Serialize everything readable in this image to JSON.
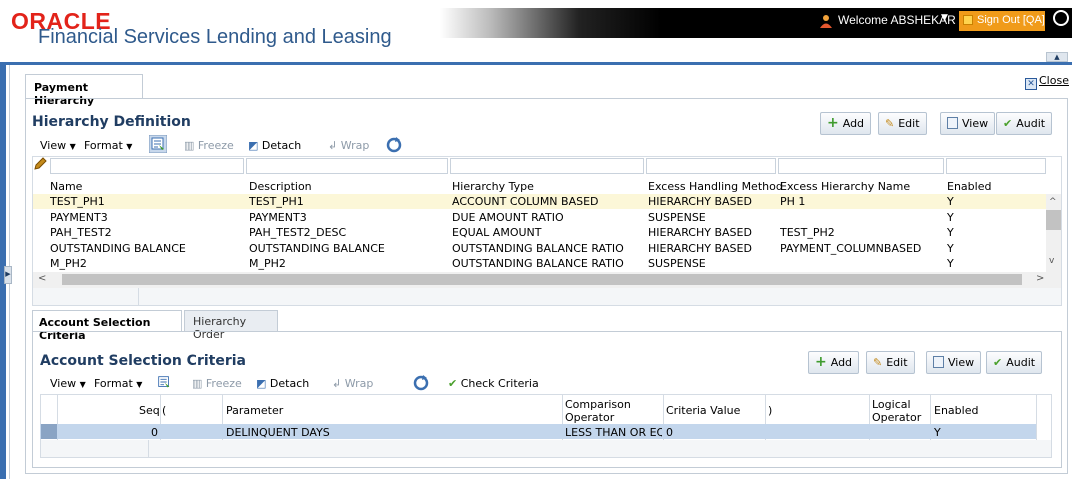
{
  "header": {
    "logo": "ORACLE",
    "app_title": "Financial Services Lending and Leasing",
    "welcome": "Welcome ABSHEKAR",
    "signout": "Sign Out [QA]"
  },
  "tab": {
    "label": "Payment Hierarchy",
    "close_label": "Close"
  },
  "hierarchy": {
    "title": "Hierarchy Definition",
    "actions": {
      "add": "Add",
      "edit": "Edit",
      "view": "View",
      "audit": "Audit"
    },
    "toolbar": {
      "view": "View",
      "format": "Format",
      "freeze": "Freeze",
      "detach": "Detach",
      "wrap": "Wrap"
    },
    "columns": [
      "Name",
      "Description",
      "Hierarchy Type",
      "Excess Handling Method",
      "Excess Hierarchy Name",
      "Enabled"
    ],
    "rows": [
      [
        "TEST_PH1",
        "TEST_PH1",
        "ACCOUNT COLUMN BASED",
        "HIERARCHY BASED",
        "PH 1",
        "Y"
      ],
      [
        "PAYMENT3",
        "PAYMENT3",
        "DUE AMOUNT RATIO",
        "SUSPENSE",
        "",
        "Y"
      ],
      [
        "PAH_TEST2",
        "PAH_TEST2_DESC",
        "EQUAL AMOUNT",
        "HIERARCHY BASED",
        "TEST_PH2",
        "Y"
      ],
      [
        "OUTSTANDING BALANCE",
        "OUTSTANDING BALANCE",
        "OUTSTANDING BALANCE RATIO",
        "HIERARCHY BASED",
        "PAYMENT_COLUMNBASED",
        "Y"
      ],
      [
        "M_PH2",
        "M_PH2",
        "OUTSTANDING BALANCE RATIO",
        "SUSPENSE",
        "",
        "Y"
      ]
    ]
  },
  "subtabs": [
    "Account Selection Criteria",
    "Hierarchy Order"
  ],
  "criteria": {
    "title": "Account Selection Criteria",
    "actions": {
      "add": "Add",
      "edit": "Edit",
      "view": "View",
      "audit": "Audit"
    },
    "toolbar": {
      "view": "View",
      "format": "Format",
      "freeze": "Freeze",
      "detach": "Detach",
      "wrap": "Wrap",
      "check": "Check Criteria"
    },
    "columns": {
      "seq": "Seq",
      "open": "(",
      "parameter": "Parameter",
      "comparison": "Comparison Operator",
      "criteria_value": "Criteria Value",
      "close": ")",
      "logical": "Logical Operator",
      "enabled": "Enabled"
    },
    "rows": [
      {
        "seq": "0",
        "open": "",
        "parameter": "DELINQUENT DAYS",
        "comparison": "LESS THAN OR EQ...",
        "criteria_value": "0",
        "close": "",
        "logical": "",
        "enabled": "Y"
      }
    ]
  }
}
